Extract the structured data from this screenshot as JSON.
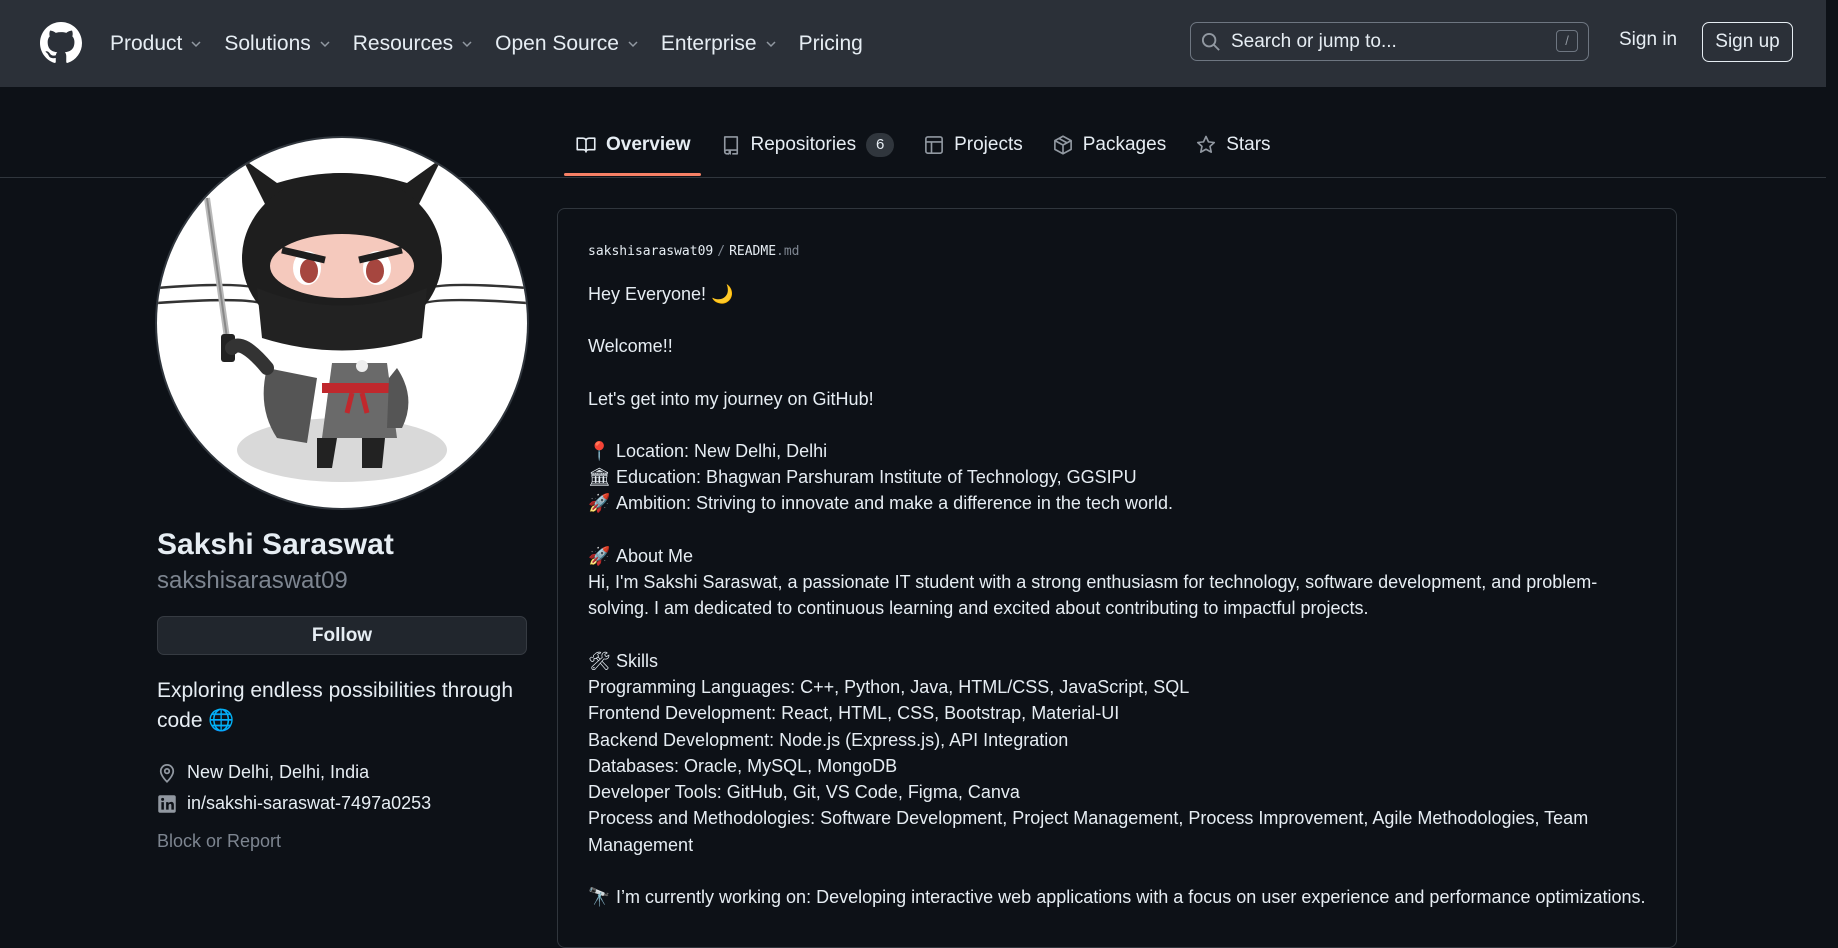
{
  "header": {
    "nav": [
      "Product",
      "Solutions",
      "Resources",
      "Open Source",
      "Enterprise",
      "Pricing"
    ],
    "search_placeholder": "Search or jump to...",
    "search_shortcut": "/",
    "signin": "Sign in",
    "signup": "Sign up"
  },
  "tabs": [
    {
      "label": "Overview",
      "icon": "book-icon",
      "active": true
    },
    {
      "label": "Repositories",
      "icon": "repo-icon",
      "count": "6"
    },
    {
      "label": "Projects",
      "icon": "table-icon"
    },
    {
      "label": "Packages",
      "icon": "package-icon"
    },
    {
      "label": "Stars",
      "icon": "star-icon"
    }
  ],
  "profile": {
    "name": "Sakshi Saraswat",
    "login": "sakshisaraswat09",
    "follow": "Follow",
    "bio_line1": "Exploring endless possibilities through",
    "bio_line2": "code",
    "bio_emoji": "🌐",
    "location": "New Delhi, Delhi, India",
    "linkedin": "in/sakshi-saraswat-7497a0253",
    "block": "Block or Report"
  },
  "readme": {
    "owner": "sakshisaraswat09",
    "sep": "/",
    "file": "README",
    "ext": ".md",
    "greeting": "Hey Everyone! 🌙",
    "welcome": "Welcome!!",
    "journey": "Let's get into my journey on GitHub!",
    "location_emoji": "📍",
    "location": "Location: New Delhi, Delhi",
    "education_emoji": "🏛",
    "education": "Education: Bhagwan Parshuram Institute of Technology, GGSIPU",
    "ambition_emoji": "🚀",
    "ambition": "Ambition: Striving to innovate and make a difference in the tech world.",
    "about_emoji": "🚀",
    "about_title": "About Me",
    "about_text": "Hi, I'm Sakshi Saraswat, a passionate IT student with a strong enthusiasm for technology, software development, and problem-solving. I am dedicated to continuous learning and excited about contributing to impactful projects.",
    "skills_emoji": "🛠",
    "skills_title": "Skills",
    "skills": [
      "Programming Languages: C++, Python, Java, HTML/CSS, JavaScript, SQL",
      "Frontend Development: React, HTML, CSS, Bootstrap, Material-UI",
      "Backend Development: Node.js (Express.js), API Integration",
      "Databases: Oracle, MySQL, MongoDB",
      "Developer Tools: GitHub, Git, VS Code, Figma, Canva",
      "Process and Methodologies: Software Development, Project Management, Process Improvement, Agile Methodologies, Team Management"
    ],
    "working_emoji": "🔭",
    "working": "I’m currently working on: Developing interactive web applications with a focus on user experience and performance optimizations."
  }
}
